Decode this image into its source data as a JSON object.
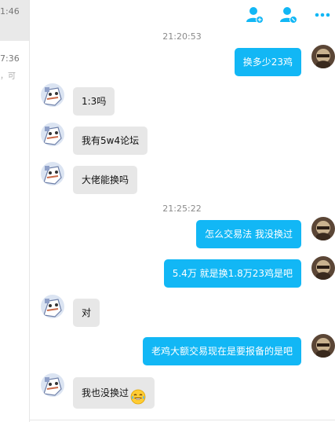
{
  "sidebar": {
    "times": [
      "1:46",
      "7:36"
    ],
    "snippet": "，可"
  },
  "toolbar": {
    "icons": [
      "add-member-icon",
      "remove-member-icon",
      "more-options-icon"
    ],
    "accent": "#12b7f5"
  },
  "chat": {
    "timestamps": [
      "21:20:53",
      "21:25:22"
    ],
    "messages": [
      {
        "dir": "out",
        "text": "换多少23鸡"
      },
      {
        "dir": "in",
        "text": "1:3吗"
      },
      {
        "dir": "in",
        "text": "我有5w4论坛"
      },
      {
        "dir": "in",
        "text": "大佬能换吗"
      },
      {
        "dir": "out",
        "text": "怎么交易法  我没换过"
      },
      {
        "dir": "out",
        "text": "5.4万 就是换1.8万23鸡是吧"
      },
      {
        "dir": "in",
        "text": "对"
      },
      {
        "dir": "out",
        "text": "老鸡大额交易现在是要报备的是吧"
      },
      {
        "dir": "in",
        "text": "我也没换过",
        "emoji": "tears-of-joy-emoji"
      }
    ]
  }
}
